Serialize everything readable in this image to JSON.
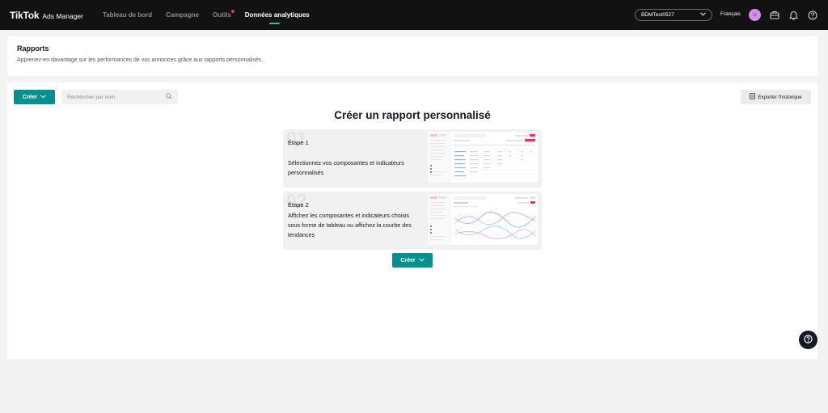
{
  "brand": {
    "logo": "TikTok",
    "sub": "Ads Manager"
  },
  "nav": [
    {
      "label": "Tableau de bord"
    },
    {
      "label": "Campagne"
    },
    {
      "label": "Outils"
    },
    {
      "label": "Données analytiques"
    }
  ],
  "account": {
    "name": "BDMTest0527"
  },
  "language": "Français",
  "avatar": {
    "initial": "U",
    "color": "#d58fe6"
  },
  "header": {
    "title": "Rapports",
    "description": "Apprenez-en davantage sur les performances de vos annonces grâce aux rapports personnalisés."
  },
  "toolbar": {
    "create_label": "Créer",
    "search_placeholder": "Rechercher par nom",
    "export_label": "Exporter l'historique"
  },
  "main": {
    "title": "Créer un rapport personnalisé",
    "steps": [
      {
        "number": "01",
        "label": "Étape 1",
        "text": "Sélectionnez vos composantes et indicateurs personnalisés"
      },
      {
        "number": "02",
        "label": "Étape 2",
        "text": "Affichez les composantes et indicateurs choisis sous forme de tableau ou affichez la courbe des tendances"
      }
    ],
    "create_label": "Créer"
  },
  "colors": {
    "primary": "#058f8f",
    "accent_red": "#fe2c55",
    "nav_active_indicator": "#25c1b3"
  },
  "icons": [
    "chevron-down-icon",
    "search-icon",
    "export-icon",
    "briefcase-icon",
    "bell-icon",
    "help-icon"
  ]
}
